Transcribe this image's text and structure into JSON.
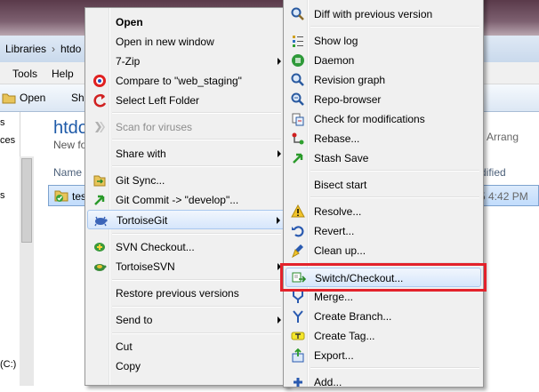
{
  "explorer": {
    "breadcrumb": [
      "Libraries",
      "htdo"
    ],
    "menus": [
      "Tools",
      "Help"
    ],
    "commands": [
      "Open",
      "Sh"
    ],
    "folder_title": "htdo",
    "folder_subtitle": "New fo",
    "column_name": "Name",
    "column_right": "dified",
    "arrange": "Arrang",
    "file_name": "tes",
    "file_date": "5 4:42 PM",
    "nav_items": [
      "s",
      "ces",
      "s",
      "(C:)"
    ]
  },
  "context_menu": {
    "items": [
      {
        "label": "Open",
        "icon": "none",
        "bold": true
      },
      {
        "label": "Open in new window",
        "icon": "none"
      },
      {
        "label": "7-Zip",
        "icon": "none",
        "submenu": true
      },
      {
        "label": "Compare to \"web_staging\"",
        "icon": "compare-icon"
      },
      {
        "label": "Select Left Folder",
        "icon": "select-left-icon"
      },
      {
        "label": "Scan for viruses",
        "icon": "scan-icon",
        "disabled": true
      },
      {
        "label": "Share with",
        "icon": "none",
        "submenu": true
      },
      {
        "label": "Git Sync...",
        "icon": "git-sync-icon"
      },
      {
        "label": "Git Commit -> \"develop\"...",
        "icon": "git-commit-icon"
      },
      {
        "label": "TortoiseGit",
        "icon": "tortoisegit-icon",
        "submenu": true,
        "highlighted": true
      },
      {
        "label": "SVN Checkout...",
        "icon": "svn-checkout-icon"
      },
      {
        "label": "TortoiseSVN",
        "icon": "tortoisesvn-icon",
        "submenu": true
      },
      {
        "label": "Restore previous versions",
        "icon": "none"
      },
      {
        "label": "Send to",
        "icon": "none",
        "submenu": true
      },
      {
        "label": "Cut",
        "icon": "none"
      },
      {
        "label": "Copy",
        "icon": "none"
      }
    ]
  },
  "tortoisegit_menu": {
    "items": [
      {
        "label": "Diff with previous version",
        "icon": "diff-icon"
      },
      {
        "label": "Show log",
        "icon": "show-log-icon"
      },
      {
        "label": "Daemon",
        "icon": "daemon-icon"
      },
      {
        "label": "Revision graph",
        "icon": "revision-graph-icon"
      },
      {
        "label": "Repo-browser",
        "icon": "repo-browser-icon"
      },
      {
        "label": "Check for modifications",
        "icon": "check-modifications-icon"
      },
      {
        "label": "Rebase...",
        "icon": "rebase-icon"
      },
      {
        "label": "Stash Save",
        "icon": "stash-save-icon"
      },
      {
        "label": "Bisect start",
        "icon": "none"
      },
      {
        "label": "Resolve...",
        "icon": "resolve-icon"
      },
      {
        "label": "Revert...",
        "icon": "revert-icon"
      },
      {
        "label": "Clean up...",
        "icon": "clean-up-icon"
      },
      {
        "label": "Switch/Checkout...",
        "icon": "switch-checkout-icon",
        "highlighted": true
      },
      {
        "label": "Merge...",
        "icon": "merge-icon"
      },
      {
        "label": "Create Branch...",
        "icon": "create-branch-icon"
      },
      {
        "label": "Create Tag...",
        "icon": "create-tag-icon"
      },
      {
        "label": "Export...",
        "icon": "export-icon"
      },
      {
        "label": "Add...",
        "icon": "add-icon"
      }
    ]
  },
  "colors": {
    "highlight_border": "#e3222b",
    "menu_background": "#f0f0f0",
    "hover_fill": "#d6e6fb"
  }
}
